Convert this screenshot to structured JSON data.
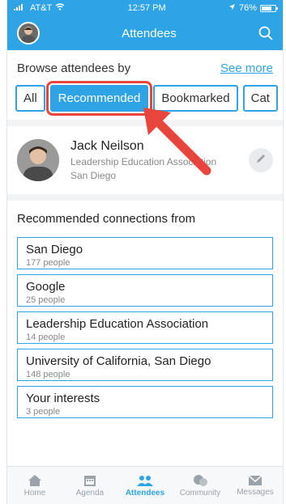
{
  "status": {
    "carrier": "AT&T",
    "time": "12:57 PM",
    "battery_text": "76%",
    "battery_level": 0.76
  },
  "nav": {
    "title": "Attendees"
  },
  "browse": {
    "label": "Browse attendees by",
    "see_more": "See more"
  },
  "tabs": [
    {
      "label": "All"
    },
    {
      "label": "Recommended"
    },
    {
      "label": "Bookmarked"
    },
    {
      "label": "Cat"
    }
  ],
  "profile": {
    "name": "Jack Neilson",
    "org": "Leadership Education Association",
    "city": "San Diego"
  },
  "recommendations": {
    "title": "Recommended connections from",
    "items": [
      {
        "name": "San Diego",
        "count": "177 people"
      },
      {
        "name": "Google",
        "count": "25 people"
      },
      {
        "name": "Leadership Education Association",
        "count": "14 people"
      },
      {
        "name": "University of California, San Diego",
        "count": "148 people"
      },
      {
        "name": "Your interests",
        "count": "3 people"
      }
    ]
  },
  "tabbar": {
    "items": [
      {
        "label": "Home",
        "icon": "home-icon"
      },
      {
        "label": "Agenda",
        "icon": "calendar-icon"
      },
      {
        "label": "Attendees",
        "icon": "people-icon"
      },
      {
        "label": "Community",
        "icon": "chat-icon"
      },
      {
        "label": "Messages",
        "icon": "envelope-icon"
      }
    ]
  },
  "colors": {
    "brand": "#2ea3e6",
    "highlight": "#e8453c"
  }
}
